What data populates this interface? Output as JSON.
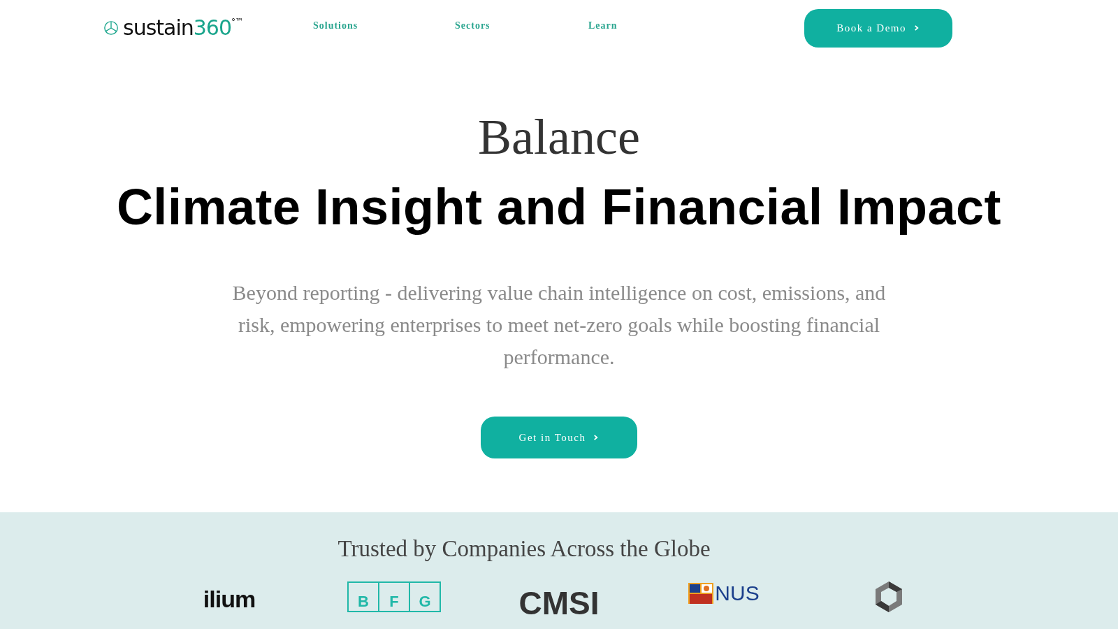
{
  "header": {
    "logo": {
      "word": "sustain",
      "number": "360",
      "mark": "°™"
    },
    "nav": [
      {
        "label": "Solutions"
      },
      {
        "label": "Sectors"
      },
      {
        "label": "Learn"
      }
    ],
    "cta": {
      "label": "Book a Demo"
    }
  },
  "hero": {
    "eyebrow": "Balance",
    "title": "Climate Insight and Financial Impact",
    "text": "Beyond reporting - delivering value chain intelligence on cost, emissions, and risk, empowering enterprises to meet net-zero goals while boosting financial performance.",
    "button": {
      "label": "Get in Touch"
    }
  },
  "clients": {
    "title": "Trusted by Companies Across the Globe",
    "logos": [
      {
        "kind": "wordmark",
        "text": "ilium"
      },
      {
        "kind": "boxed",
        "letters": [
          "B",
          "F",
          "G"
        ]
      },
      {
        "kind": "cmsi",
        "text": "CMSI"
      },
      {
        "kind": "crest",
        "text": "NUS"
      },
      {
        "kind": "emblem"
      }
    ]
  }
}
